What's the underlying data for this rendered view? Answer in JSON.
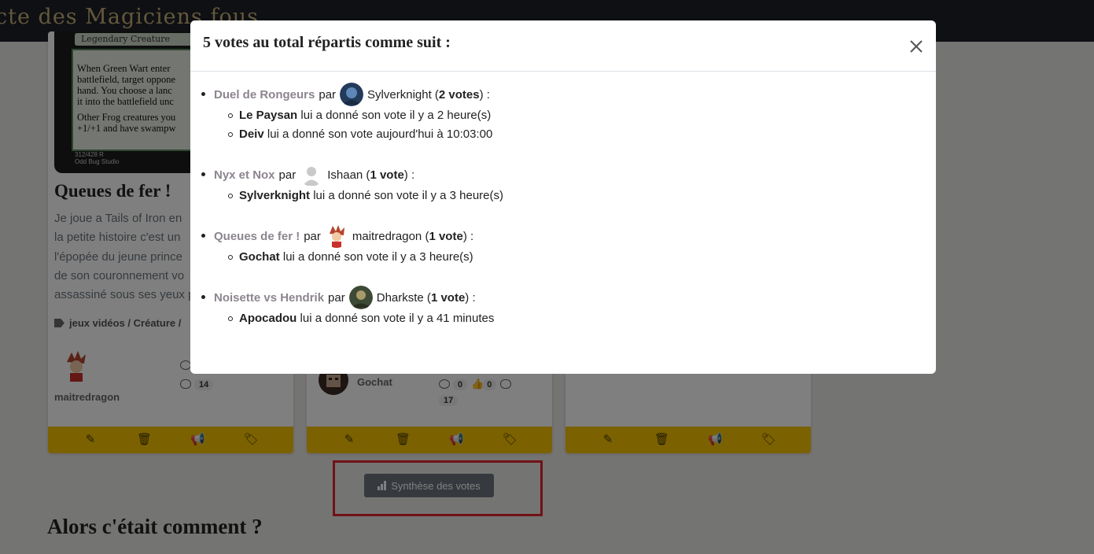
{
  "site": {
    "title": "cte des Magiciens fous"
  },
  "cards": [
    {
      "mtg": {
        "type_line": "Legendary Creature",
        "text_lines": [
          "When Green Wart enter",
          "battlefield, target oppone",
          "hand. You choose a lanc",
          "it into the battlefield unc"
        ],
        "text_lines2": [
          "Other Frog creatures you",
          "+1/+1 and have swampw"
        ],
        "collector": "312/428 R",
        "studio": "Odd Bug Studio"
      },
      "title": "Queues de fer !",
      "desc": [
        "Je joue a Tails of Iron en",
        "la petite histoire c'est un",
        "l'épopée du jeune prince",
        "de son couronnement vo",
        "assassiné sous ses yeux p"
      ],
      "tags": "jeux vidéos / Créature /",
      "author": "maitredragon",
      "views": "14"
    },
    {
      "author": "Gochat",
      "comments": "0",
      "likes": "0",
      "views": "17"
    },
    {}
  ],
  "synth_button": "Synthèse des votes",
  "section_title": "Alors c'était comment ?",
  "modal": {
    "title": "5 votes au total répartis comme suit :",
    "groups": [
      {
        "entry": "Duel de Rongeurs",
        "par": "par",
        "author": "Sylverknight",
        "count": "2 votes",
        "voters": [
          {
            "name": "Le Paysan",
            "text": "lui a donné son vote il y a 2 heure(s)"
          },
          {
            "name": "Deiv",
            "text": "lui a donné son vote aujourd'hui à 10:03:00"
          }
        ]
      },
      {
        "entry": "Nyx et Nox",
        "par": "par",
        "author": "Ishaan",
        "count": "1 vote",
        "voters": [
          {
            "name": "Sylverknight",
            "text": "lui a donné son vote il y a 3 heure(s)"
          }
        ]
      },
      {
        "entry": "Queues de fer !",
        "par": "par",
        "author": "maitredragon",
        "count": "1 vote",
        "voters": [
          {
            "name": "Gochat",
            "text": "lui a donné son vote il y a 3 heure(s)"
          }
        ]
      },
      {
        "entry": "Noisette vs Hendrik",
        "par": "par",
        "author": "Dharkste",
        "count": "1 vote",
        "voters": [
          {
            "name": "Apocadou",
            "text": "lui a donné son vote il y a 41 minutes"
          }
        ]
      }
    ]
  },
  "colors": {
    "footer": "#f7c300",
    "link": "#8c858e",
    "highlight": "#e0242c",
    "button": "#6c757d"
  }
}
